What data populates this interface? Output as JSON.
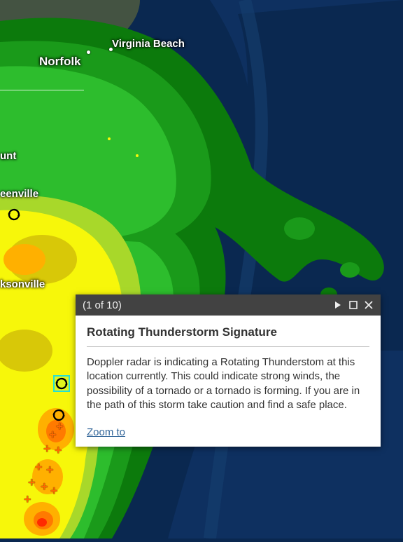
{
  "popup": {
    "pager": "(1 of 10)",
    "title": "Rotating Thunderstorm Signature",
    "description": "Doppler radar is indicating a Rotating Thunderstom at this location currently.  This could indicate strong winds, the possibility of a tornado or a tornado is forming.  If you are in the path of this storm take caution and find a safe place.",
    "zoom_label": "Zoom to"
  },
  "cities": {
    "norfolk": "Norfolk",
    "virginia_beach": "Virginia Beach",
    "mount": "unt",
    "greenville": "eenville",
    "jacksonville": "ksonville"
  },
  "radar_palette": {
    "water": "#0a2850",
    "light_green": "#1a9a1a",
    "green": "#2dbd2d",
    "dark_green": "#0c7a0c",
    "yellow_green": "#a8d82a",
    "yellow": "#f7f70a",
    "dark_yellow": "#d8c808",
    "orange": "#ffb000",
    "dark_orange": "#ff7a00",
    "red": "#ff2a00"
  }
}
